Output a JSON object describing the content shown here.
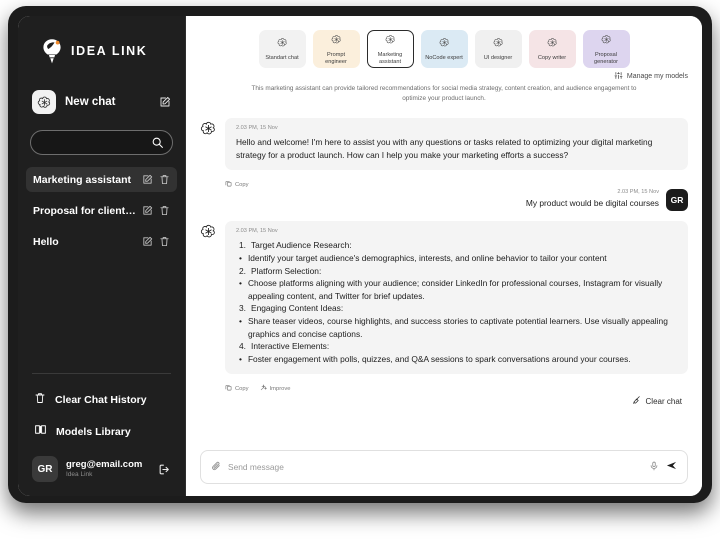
{
  "brand": {
    "name": "IDEA LINK",
    "logo_icon": "lightbulb-idea-icon"
  },
  "sidebar": {
    "new_chat": {
      "label": "New chat",
      "logo_icon": "openai-flower-icon",
      "edit_icon": "edit-square-icon"
    },
    "search": {
      "value": "",
      "placeholder": "",
      "icon": "search-icon"
    },
    "chats": [
      {
        "title": "Marketing assistant",
        "active": true,
        "edit_icon": "edit-square-icon",
        "delete_icon": "trash-icon"
      },
      {
        "title": "Proposal for clients...",
        "active": false,
        "edit_icon": "edit-square-icon",
        "delete_icon": "trash-icon"
      },
      {
        "title": "Hello",
        "active": false,
        "edit_icon": "edit-square-icon",
        "delete_icon": "trash-icon"
      }
    ],
    "footer": [
      {
        "label": "Clear Chat History",
        "icon": "trash-icon"
      },
      {
        "label": "Models Library",
        "icon": "book-open-icon"
      }
    ],
    "user": {
      "initials": "GR",
      "email": "greg@email.com",
      "org": "Idea Link",
      "logout_icon": "logout-arrow-icon"
    }
  },
  "header": {
    "cards": [
      {
        "label": "Standart chat",
        "color": "#f2f2f2",
        "selected": false,
        "icon": "openai-flower-icon"
      },
      {
        "label": "Prompt engineer",
        "color": "#fbefdc",
        "selected": false,
        "icon": "openai-flower-icon"
      },
      {
        "label": "Marketing assistant",
        "color": "#ffffff",
        "selected": true,
        "icon": "openai-flower-icon"
      },
      {
        "label": "NoCode expert",
        "color": "#dbeaf4",
        "selected": false,
        "icon": "openai-flower-icon"
      },
      {
        "label": "UI designer",
        "color": "#f0f0f0",
        "selected": false,
        "icon": "openai-flower-icon"
      },
      {
        "label": "Copy writer",
        "color": "#f5e4e6",
        "selected": false,
        "icon": "openai-flower-icon"
      },
      {
        "label": "Proposal generator",
        "color": "#ddd5ef",
        "selected": false,
        "icon": "openai-flower-icon"
      }
    ],
    "manage": {
      "label": "Manage my models",
      "icon": "sliders-icon"
    },
    "blurb": "This marketing assistant can provide tailored recommendations for social media strategy, content creation, and audience engagement to optimize your product launch."
  },
  "thread": {
    "message1": {
      "timestamp": "2.03 PM, 15 Nov",
      "text": "Hello and welcome!  I'm here to assist you with any questions or tasks related to optimizing your digital marketing strategy for a product launch. How can I help you make your marketing efforts a success?",
      "actions": [
        {
          "label": "Copy",
          "icon": "copy-icon"
        }
      ]
    },
    "message2": {
      "timestamp": "2.03 PM, 15 Nov",
      "text": "My product would be digital courses",
      "avatar": "GR"
    },
    "message3": {
      "timestamp": "2.03 PM, 15 Nov",
      "items": [
        {
          "n": "1.",
          "heading": "Target Audience Research:",
          "bullet": "Identify your target audience's demographics, interests, and online behavior to tailor your content"
        },
        {
          "n": "2.",
          "heading": "Platform Selection:",
          "bullet": "Choose platforms aligning with your audience; consider LinkedIn for professional courses, Instagram for visually appealing content, and Twitter for brief updates."
        },
        {
          "n": "3.",
          "heading": "Engaging Content Ideas:",
          "bullet": "Share teaser videos, course highlights, and success stories to captivate potential learners. Use visually appealing graphics and concise captions."
        },
        {
          "n": "4.",
          "heading": "Interactive Elements:",
          "bullet": "Foster engagement with polls, quizzes, and Q&A sessions to spark conversations around your courses."
        }
      ],
      "actions": [
        {
          "label": "Copy",
          "icon": "copy-icon"
        },
        {
          "label": "Improve",
          "icon": "sparkles-icon"
        }
      ]
    },
    "clear_chat": {
      "label": "Clear chat",
      "icon": "broom-icon"
    }
  },
  "composer": {
    "placeholder": "Send message",
    "value": "",
    "attach_icon": "paperclip-icon",
    "mic_icon": "microphone-icon",
    "send_icon": "send-plane-icon"
  }
}
